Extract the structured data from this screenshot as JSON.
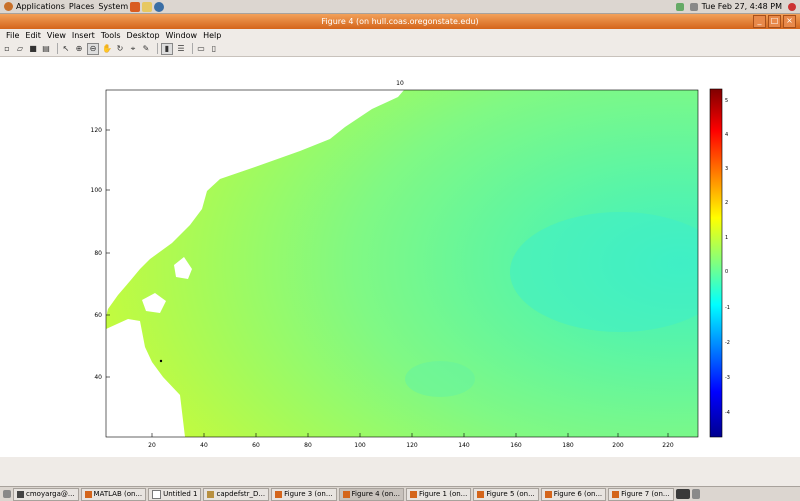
{
  "top_panel": {
    "menus": [
      "Applications",
      "Places",
      "System"
    ],
    "clock": "Tue Feb 27, 4:48 PM"
  },
  "window": {
    "title": "Figure 4 (on hull.coas.oregonstate.edu)"
  },
  "menubar": [
    "File",
    "Edit",
    "View",
    "Insert",
    "Tools",
    "Desktop",
    "Window",
    "Help"
  ],
  "toolbar_icons": [
    "new-figure-icon",
    "open-file-icon",
    "save-icon",
    "print-icon",
    "edit-plot-icon",
    "zoom-in-icon",
    "zoom-out-icon",
    "pan-icon",
    "rotate-icon",
    "data-cursor-icon",
    "brush-icon",
    "colorbar-icon",
    "legend-icon",
    "hide-plot-tools-icon",
    "show-plot-tools-icon"
  ],
  "plot": {
    "title": "10",
    "x_ticks": [
      "20",
      "40",
      "60",
      "80",
      "100",
      "120",
      "140",
      "160",
      "180",
      "200",
      "220"
    ],
    "y_ticks": [
      "40",
      "60",
      "80",
      "100",
      "120"
    ],
    "colorbar_ticks": [
      "5",
      "4",
      "3",
      "2",
      "1",
      "0",
      "-1",
      "-2",
      "-3",
      "-4"
    ]
  },
  "taskbar": [
    {
      "label": "cmoyarga@..."
    },
    {
      "label": "MATLAB (on..."
    },
    {
      "label": "Untitled 1"
    },
    {
      "label": "capdefstr_D..."
    },
    {
      "label": "Figure 3 (on..."
    },
    {
      "label": "Figure 4 (on...",
      "active": true
    },
    {
      "label": "Figure 1 (on..."
    },
    {
      "label": "Figure 5 (on..."
    },
    {
      "label": "Figure 6 (on..."
    },
    {
      "label": "Figure 7 (on..."
    }
  ]
}
